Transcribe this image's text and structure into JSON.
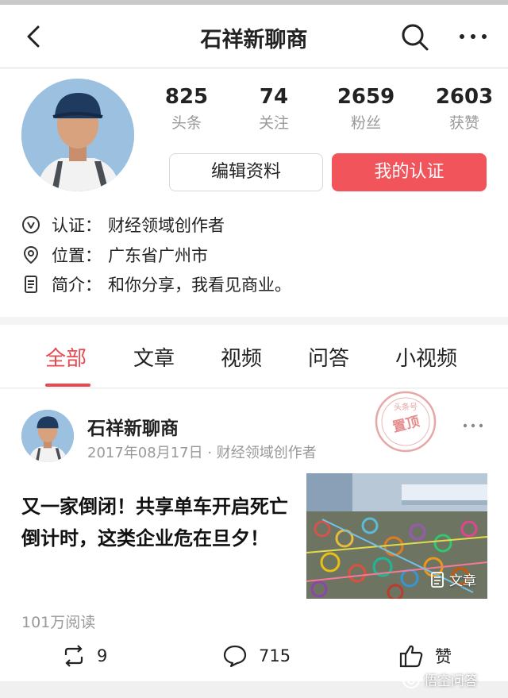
{
  "header": {
    "title": "石祥新聊商",
    "icons": [
      "back-arrow-icon",
      "search-icon",
      "more-dots-icon"
    ]
  },
  "profile": {
    "stats": [
      {
        "value": "825",
        "label": "头条"
      },
      {
        "value": "74",
        "label": "关注"
      },
      {
        "value": "2659",
        "label": "粉丝"
      },
      {
        "value": "2603",
        "label": "获赞"
      }
    ],
    "edit_button": "编辑资料",
    "verify_button": "我的认证",
    "verify_color": "#f2545b",
    "info": [
      {
        "icon": "verified-icon",
        "label": "认证：",
        "value": "财经领域创作者"
      },
      {
        "icon": "location-pin-icon",
        "label": "位置：",
        "value": "广东省广州市"
      },
      {
        "icon": "document-icon",
        "label": "简介：",
        "value": "和你分享，我看见商业。"
      }
    ]
  },
  "tabs": {
    "items": [
      "全部",
      "文章",
      "视频",
      "问答",
      "小视频"
    ],
    "active_index": 0,
    "active_color": "#e8484f"
  },
  "post": {
    "author": "石祥新聊商",
    "meta": "2017年08月17日 · 财经领域创作者",
    "stamp_top": "头条号",
    "stamp_text": "置顶",
    "headline": "又一家倒闭！共享单车开启死亡倒计时，这类企业危在旦夕！",
    "thumb_badge": "文章",
    "reads": "101万阅读",
    "shares": "9",
    "comments": "715",
    "like_label": "赞"
  },
  "watermark": "悟空问答"
}
